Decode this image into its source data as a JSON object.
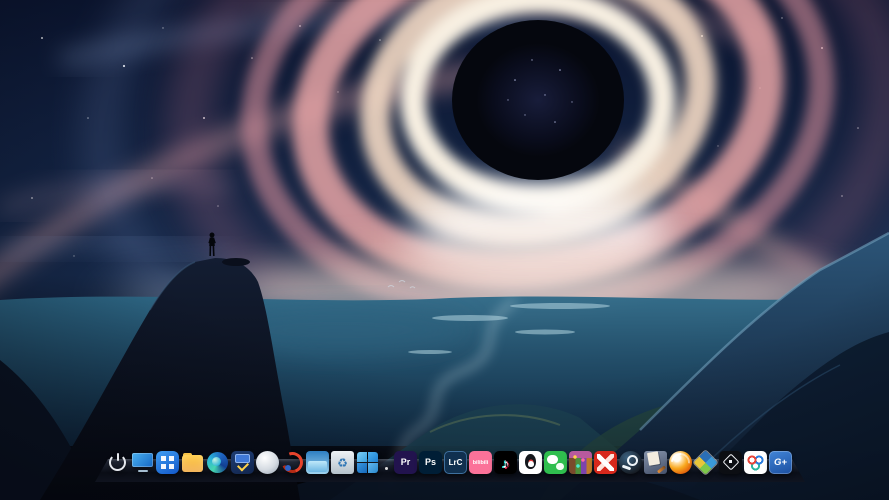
{
  "wallpaper": {
    "alt": "Painted black-hole vortex with pink and cream swirls over a dark blue valley; a lone figure stands on a cliff at left"
  },
  "dock": {
    "icons": [
      {
        "id": "power",
        "name": "power-icon"
      },
      {
        "id": "desktop",
        "name": "monitor-icon"
      },
      {
        "id": "launcher",
        "name": "app-launcher-grid-icon"
      },
      {
        "id": "files",
        "name": "file-manager-folder-icon"
      },
      {
        "id": "edge",
        "name": "edge-browser-icon"
      },
      {
        "id": "toolbox",
        "name": "toolbox-icon"
      },
      {
        "id": "sphere",
        "name": "white-sphere-app-icon"
      },
      {
        "id": "redswoosh",
        "name": "red-swirl-app-icon"
      },
      {
        "id": "appglass",
        "name": "blue-window-app-icon"
      },
      {
        "id": "trash",
        "name": "recycle-bin-icon",
        "glyph": "♻"
      },
      {
        "id": "wintiles",
        "name": "windows-tiles-icon"
      },
      {
        "id": "dot",
        "name": "dock-indicator-dot",
        "type": "dot"
      },
      {
        "id": "premiere",
        "name": "adobe-premiere-icon",
        "glyph": "Pr",
        "bg": "#22134e",
        "fg": "#b9a1ff"
      },
      {
        "id": "photoshop",
        "name": "adobe-photoshop-icon",
        "glyph": "Ps",
        "bg": "#001e36",
        "fg": "#31a8ff"
      },
      {
        "id": "lightroom",
        "name": "adobe-lightroom-classic-icon",
        "glyph": "LrC",
        "bg": "#10304f",
        "fg": "#a9d7ff"
      },
      {
        "id": "bilibili",
        "name": "bilibili-icon",
        "glyph": "bilibili",
        "bg": "#fb7299",
        "fg": "#ffffff"
      },
      {
        "id": "douyin",
        "name": "tiktok-douyin-icon",
        "glyph": "♪",
        "bg": "#000000",
        "fg": "#ffffff"
      },
      {
        "id": "qq",
        "name": "qq-penguin-icon",
        "bg": "#ffffff"
      },
      {
        "id": "wechat",
        "name": "wechat-icon",
        "bg": "#2fbe4e"
      },
      {
        "id": "pixelgame",
        "name": "pixel-game-icon"
      },
      {
        "id": "redgame",
        "name": "red-game-app-icon",
        "bg": "#d8281c"
      },
      {
        "id": "steam",
        "name": "steam-icon"
      },
      {
        "id": "docs",
        "name": "documents-folder-icon"
      },
      {
        "id": "orangeball",
        "name": "orange-sphere-app-icon"
      },
      {
        "id": "diamond",
        "name": "diamond-tiles-app-icon"
      },
      {
        "id": "blackcube",
        "name": "cube-app-icon",
        "bg": "#0c0e13"
      },
      {
        "id": "rings",
        "name": "tri-rings-app-icon"
      },
      {
        "id": "gplus",
        "name": "g-plus-app-icon",
        "glyph": "G+",
        "fg": "#ffffff"
      }
    ]
  },
  "colors": {
    "sky_navy": "#16294a",
    "swirl_pink": "#e8a4a6",
    "swirl_cream": "#f3d9c4",
    "hole_black": "#05070e",
    "water_teal": "#2a5a78",
    "wechat_green": "#2fbe4e",
    "bilibili_pink": "#fb7299",
    "douyin_cyan": "#25f4ee",
    "douyin_red": "#fe2c55",
    "photoshop_blue": "#31a8ff",
    "steam_dark": "#171d25"
  }
}
